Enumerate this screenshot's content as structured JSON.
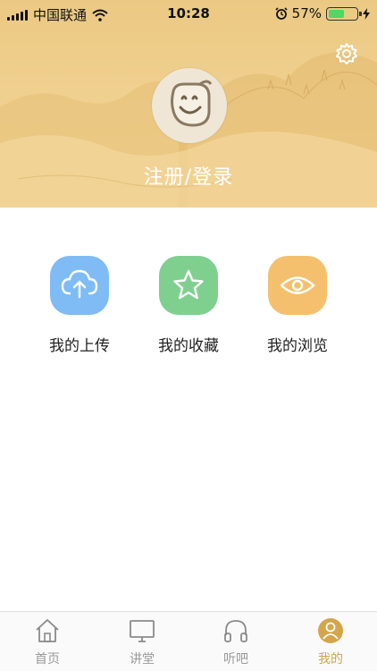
{
  "status_bar": {
    "carrier": "中国联通",
    "time": "10:28",
    "battery_percent": "57%",
    "battery_level": 0.57,
    "icons": [
      "signal-icon",
      "wifi-icon",
      "alarm-icon",
      "battery-icon",
      "charging-icon"
    ]
  },
  "header": {
    "login_label": "注册/登录",
    "colors": {
      "background": "#efcf8e",
      "text": "#ffffff"
    }
  },
  "features": [
    {
      "label": "我的上传",
      "icon": "cloud-upload-icon",
      "color": "#7fbcf5"
    },
    {
      "label": "我的收藏",
      "icon": "star-icon",
      "color": "#7fd08f"
    },
    {
      "label": "我的浏览",
      "icon": "eye-icon",
      "color": "#f4c06d"
    }
  ],
  "tabbar": {
    "items": [
      {
        "label": "首页",
        "icon": "home-icon"
      },
      {
        "label": "讲堂",
        "icon": "monitor-icon"
      },
      {
        "label": "听吧",
        "icon": "headphones-icon"
      },
      {
        "label": "我的",
        "icon": "user-icon",
        "active": true
      }
    ],
    "active_color": "#d4a54a",
    "inactive_color": "#999999"
  }
}
